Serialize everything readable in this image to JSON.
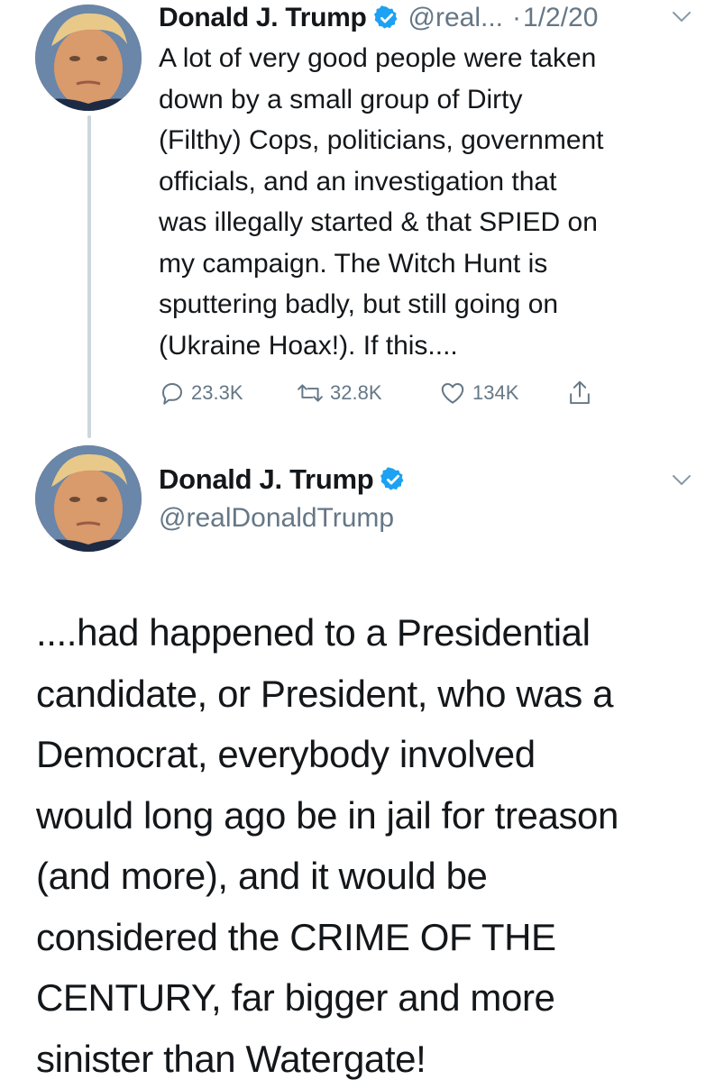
{
  "colors": {
    "verified_blue": "#1da1f2",
    "secondary_text": "#657786",
    "primary_text": "#14171a",
    "thread_line": "#ccd6dd"
  },
  "tweets": [
    {
      "author_name": "Donald J. Trump",
      "handle": "@real...",
      "separator": "·",
      "date": "1/2/20",
      "text": "A lot of very good people were taken\ndown by a small group of Dirty\n(Filthy) Cops, politicians, government\nofficials, and an investigation that\nwas illegally started & that SPIED on\nmy campaign. The Witch Hunt is\nsputtering badly, but still going on\n(Ukraine Hoax!). If this....",
      "replies": "23.3K",
      "retweets": "32.8K",
      "likes": "134K",
      "icons": [
        "reply-icon",
        "retweet-icon",
        "like-icon",
        "share-icon",
        "verified-badge-icon",
        "chevron-down-icon"
      ]
    },
    {
      "author_name": "Donald J. Trump",
      "handle": "@realDonaldTrump",
      "text": "....had happened to a Presidential\ncandidate, or President, who was a\nDemocrat, everybody involved\nwould long ago be in jail for treason\n(and more), and it would be\nconsidered the CRIME OF THE\nCENTURY, far bigger and more\nsinister than Watergate!",
      "icons": [
        "verified-badge-icon",
        "chevron-down-icon"
      ]
    }
  ]
}
